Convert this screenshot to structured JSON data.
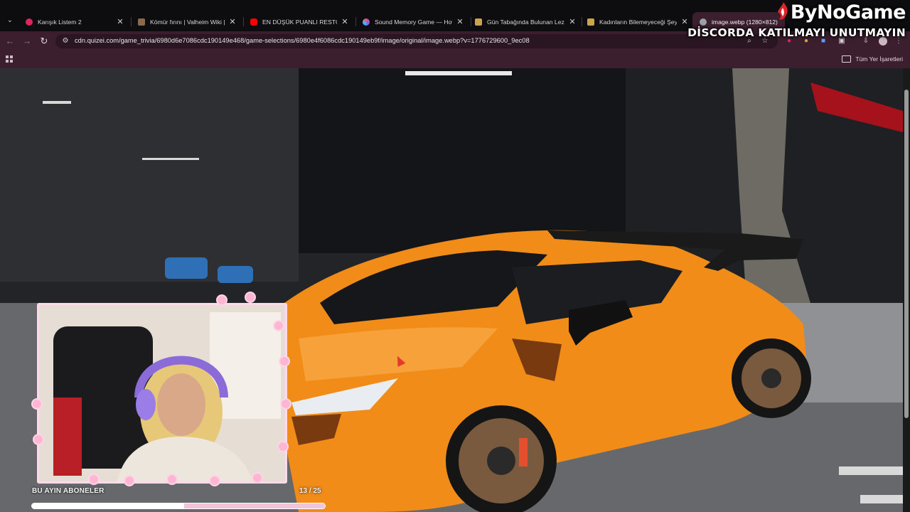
{
  "browser": {
    "tabs": [
      {
        "title": "Karışık Listem 2",
        "favicon_color": "#e0245e"
      },
      {
        "title": "Kömür fırını | Valheim Wiki | Ha",
        "favicon_color": "#8a6a4a"
      },
      {
        "title": "EN DÜŞÜK PUANLI RESTORAN",
        "favicon_color": "#ff0000"
      },
      {
        "title": "Sound Memory Game — How",
        "favicon_color": "#7a5cff"
      },
      {
        "title": "Gün Tabağında Bulunan Lezzet",
        "favicon_color": "#c8a64a"
      },
      {
        "title": "Kadınların Bilemeyeceği Şeyler",
        "favicon_color": "#c8a64a"
      },
      {
        "title": "image.webp (1280×812)",
        "favicon_color": "#9aa0a6",
        "active": true
      }
    ],
    "url": "cdn.quizei.com/game_trivia/6980d6e7086cdc190149e468/game-selections/6980e4f6086cdc190149eb9f/image/original/image.webp?v=1776729600_9ec08",
    "bookmarks_all_label": "Tüm Yer İşaretleri",
    "theme_color": "#3b1f2e"
  },
  "overlay": {
    "brand_logo": "ByNoGame",
    "brand_subtitle": "DİSCORDA KATILMAYI UNUTMAYIN",
    "subscribers_label": "BU AYIN ABONELER",
    "subscribers_count_text": "13 / 25",
    "subscribers_progress": 0.52
  },
  "image": {
    "car_color": "#f28c18",
    "background_color": "#24262a"
  }
}
